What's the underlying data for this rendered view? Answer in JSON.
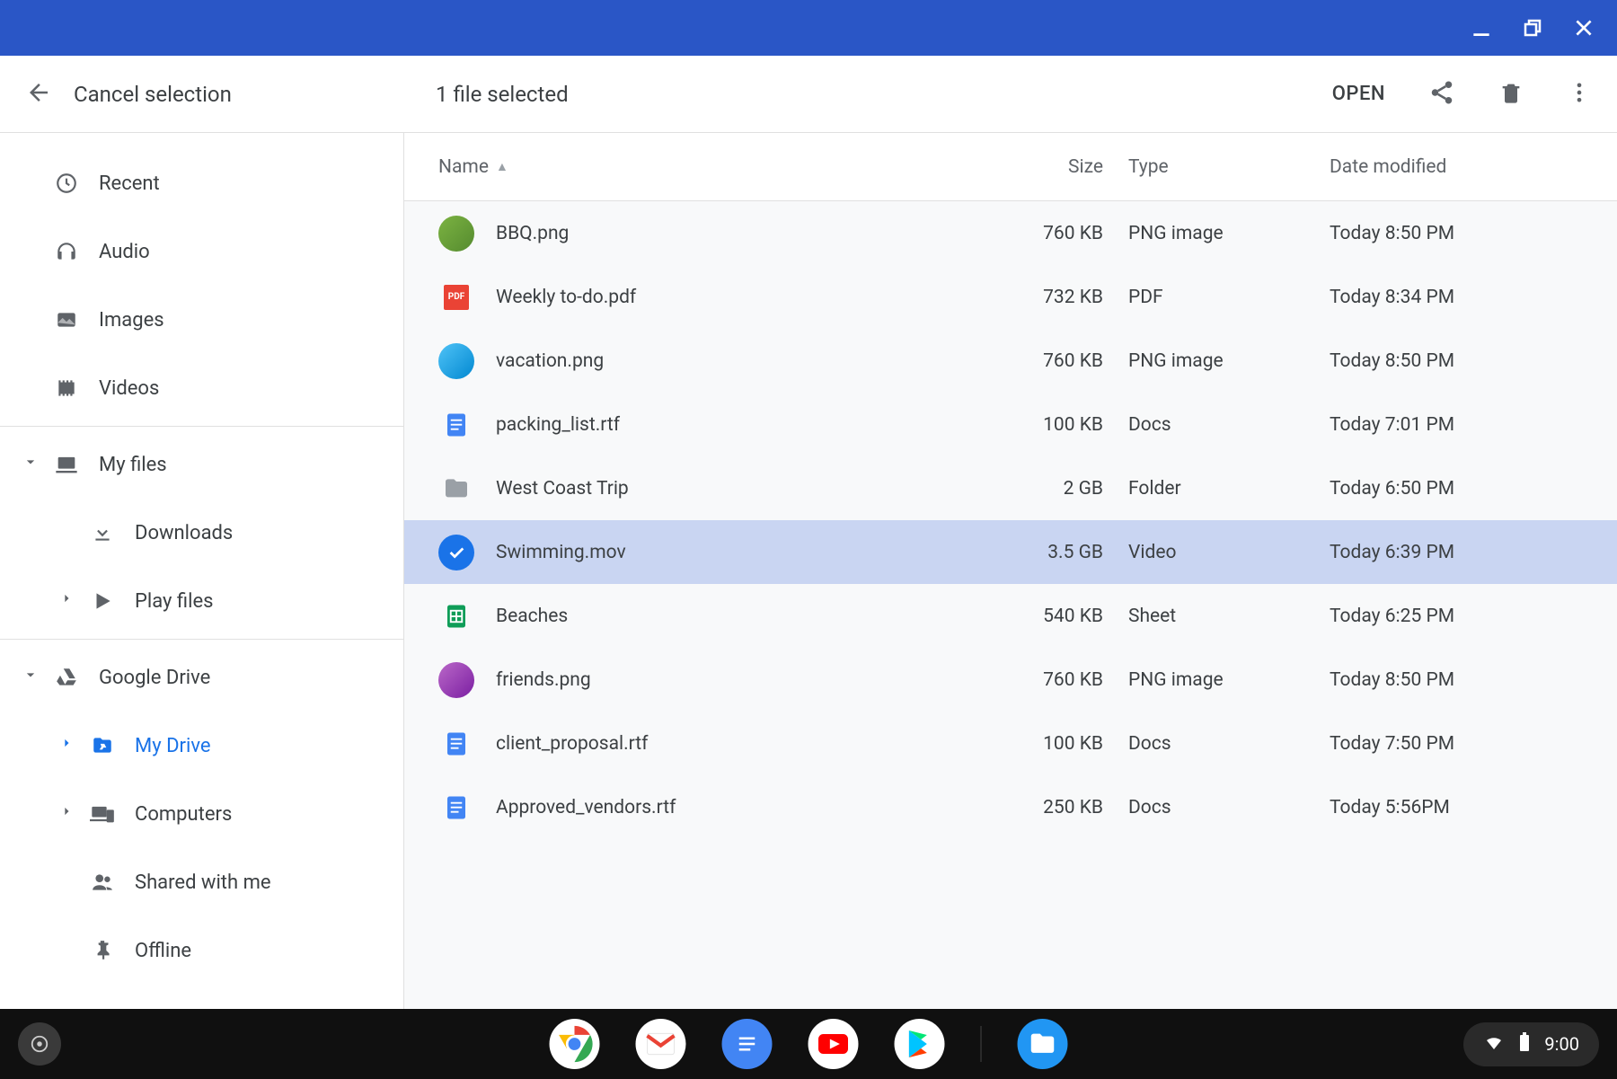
{
  "titlebar": {},
  "toolbar": {
    "cancel_label": "Cancel selection",
    "status": "1 file selected",
    "open_label": "OPEN"
  },
  "sidebar": {
    "recent": "Recent",
    "audio": "Audio",
    "images": "Images",
    "videos": "Videos",
    "myfiles": "My files",
    "downloads": "Downloads",
    "playfiles": "Play files",
    "gdrive": "Google Drive",
    "mydrive": "My Drive",
    "computers": "Computers",
    "shared": "Shared with me",
    "offline": "Offline"
  },
  "columns": {
    "name": "Name",
    "size": "Size",
    "type": "Type",
    "date": "Date modified"
  },
  "files": [
    {
      "name": "BBQ.png",
      "size": "760 KB",
      "type": "PNG image",
      "date": "Today 8:50 PM",
      "icon": "photo1",
      "selected": false
    },
    {
      "name": "Weekly to-do.pdf",
      "size": "732 KB",
      "type": "PDF",
      "date": "Today 8:34 PM",
      "icon": "pdf",
      "selected": false
    },
    {
      "name": "vacation.png",
      "size": "760 KB",
      "type": "PNG image",
      "date": "Today 8:50 PM",
      "icon": "photo2",
      "selected": false
    },
    {
      "name": "packing_list.rtf",
      "size": "100 KB",
      "type": "Docs",
      "date": "Today 7:01 PM",
      "icon": "docs",
      "selected": false
    },
    {
      "name": "West Coast Trip",
      "size": "2 GB",
      "type": "Folder",
      "date": "Today 6:50 PM",
      "icon": "folder",
      "selected": false
    },
    {
      "name": "Swimming.mov",
      "size": "3.5 GB",
      "type": "Video",
      "date": "Today 6:39 PM",
      "icon": "check",
      "selected": true
    },
    {
      "name": "Beaches",
      "size": "540 KB",
      "type": "Sheet",
      "date": "Today 6:25 PM",
      "icon": "sheet",
      "selected": false
    },
    {
      "name": "friends.png",
      "size": "760 KB",
      "type": "PNG image",
      "date": "Today 8:50 PM",
      "icon": "photo3",
      "selected": false
    },
    {
      "name": "client_proposal.rtf",
      "size": "100 KB",
      "type": "Docs",
      "date": "Today 7:50 PM",
      "icon": "docs",
      "selected": false
    },
    {
      "name": "Approved_vendors.rtf",
      "size": "250 KB",
      "type": "Docs",
      "date": "Today 5:56PM",
      "icon": "docs",
      "selected": false
    }
  ],
  "taskbar": {
    "time": "9:00"
  }
}
